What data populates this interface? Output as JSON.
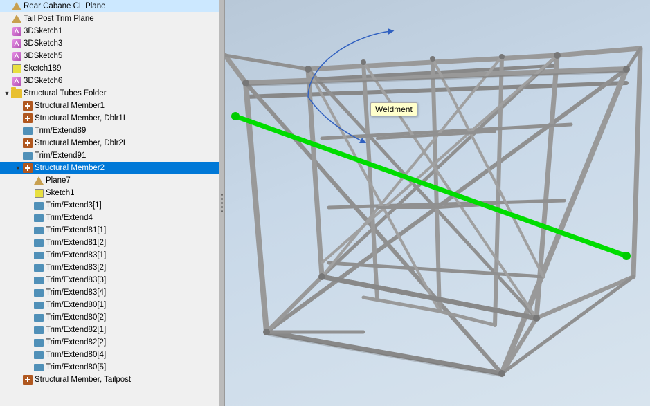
{
  "tree": {
    "items": [
      {
        "id": "rear-cabane",
        "label": "Rear Cabane CL Plane",
        "indent": 0,
        "icon": "plane",
        "expand": null,
        "selected": false
      },
      {
        "id": "tail-post",
        "label": "Tail Post Trim Plane",
        "indent": 0,
        "icon": "plane",
        "expand": null,
        "selected": false
      },
      {
        "id": "3dsketch1",
        "label": "3DSketch1",
        "indent": 0,
        "icon": "sketch3d",
        "expand": null,
        "selected": false
      },
      {
        "id": "3dsketch3",
        "label": "3DSketch3",
        "indent": 0,
        "icon": "sketch3d",
        "expand": null,
        "selected": false
      },
      {
        "id": "3dsketch5",
        "label": "3DSketch5",
        "indent": 0,
        "icon": "sketch3d",
        "expand": null,
        "selected": false
      },
      {
        "id": "sketch189",
        "label": "Sketch189",
        "indent": 0,
        "icon": "sketch",
        "expand": null,
        "selected": false
      },
      {
        "id": "3dsketch6",
        "label": "3DSketch6",
        "indent": 0,
        "icon": "sketch3d",
        "expand": null,
        "selected": false
      },
      {
        "id": "struct-tubes-folder",
        "label": "Structural Tubes Folder",
        "indent": 0,
        "icon": "folder",
        "expand": "open",
        "selected": false
      },
      {
        "id": "struct-member1",
        "label": "Structural Member1",
        "indent": 1,
        "icon": "structural",
        "expand": null,
        "selected": false
      },
      {
        "id": "struct-dblr1l",
        "label": "Structural Member, Dblr1L",
        "indent": 1,
        "icon": "structural",
        "expand": null,
        "selected": false
      },
      {
        "id": "trim89",
        "label": "Trim/Extend89",
        "indent": 1,
        "icon": "trim",
        "expand": null,
        "selected": false
      },
      {
        "id": "struct-dblr2l",
        "label": "Structural Member, Dblr2L",
        "indent": 1,
        "icon": "structural",
        "expand": null,
        "selected": false
      },
      {
        "id": "trim91",
        "label": "Trim/Extend91",
        "indent": 1,
        "icon": "trim",
        "expand": null,
        "selected": false
      },
      {
        "id": "struct-member2",
        "label": "Structural Member2",
        "indent": 1,
        "icon": "structural",
        "expand": "open",
        "selected": true
      },
      {
        "id": "plane7",
        "label": "Plane7",
        "indent": 2,
        "icon": "plane",
        "expand": null,
        "selected": false
      },
      {
        "id": "sketch1",
        "label": "Sketch1",
        "indent": 2,
        "icon": "sketch",
        "expand": null,
        "selected": false
      },
      {
        "id": "trim3-1",
        "label": "Trim/Extend3[1]",
        "indent": 2,
        "icon": "trim",
        "expand": null,
        "selected": false
      },
      {
        "id": "trim4",
        "label": "Trim/Extend4",
        "indent": 2,
        "icon": "trim",
        "expand": null,
        "selected": false
      },
      {
        "id": "trim81-1",
        "label": "Trim/Extend81[1]",
        "indent": 2,
        "icon": "trim",
        "expand": null,
        "selected": false
      },
      {
        "id": "trim81-2",
        "label": "Trim/Extend81[2]",
        "indent": 2,
        "icon": "trim",
        "expand": null,
        "selected": false
      },
      {
        "id": "trim83-1",
        "label": "Trim/Extend83[1]",
        "indent": 2,
        "icon": "trim",
        "expand": null,
        "selected": false
      },
      {
        "id": "trim83-2",
        "label": "Trim/Extend83[2]",
        "indent": 2,
        "icon": "trim",
        "expand": null,
        "selected": false
      },
      {
        "id": "trim83-3",
        "label": "Trim/Extend83[3]",
        "indent": 2,
        "icon": "trim",
        "expand": null,
        "selected": false
      },
      {
        "id": "trim83-4",
        "label": "Trim/Extend83[4]",
        "indent": 2,
        "icon": "trim",
        "expand": null,
        "selected": false
      },
      {
        "id": "trim80-1",
        "label": "Trim/Extend80[1]",
        "indent": 2,
        "icon": "trim",
        "expand": null,
        "selected": false
      },
      {
        "id": "trim80-2",
        "label": "Trim/Extend80[2]",
        "indent": 2,
        "icon": "trim",
        "expand": null,
        "selected": false
      },
      {
        "id": "trim82-1",
        "label": "Trim/Extend82[1]",
        "indent": 2,
        "icon": "trim",
        "expand": null,
        "selected": false
      },
      {
        "id": "trim82-2",
        "label": "Trim/Extend82[2]",
        "indent": 2,
        "icon": "trim",
        "expand": null,
        "selected": false
      },
      {
        "id": "trim80-4",
        "label": "Trim/Extend80[4]",
        "indent": 2,
        "icon": "trim",
        "expand": null,
        "selected": false
      },
      {
        "id": "trim80-5",
        "label": "Trim/Extend80[5]",
        "indent": 2,
        "icon": "trim",
        "expand": null,
        "selected": false
      },
      {
        "id": "struct-tailpost",
        "label": "Structural Member, Tailpost",
        "indent": 1,
        "icon": "structural",
        "expand": null,
        "selected": false
      }
    ]
  },
  "tooltip": {
    "label": "Weldment"
  },
  "viewport": {
    "background_start": "#b8c8d8",
    "background_end": "#d8e4ee"
  }
}
